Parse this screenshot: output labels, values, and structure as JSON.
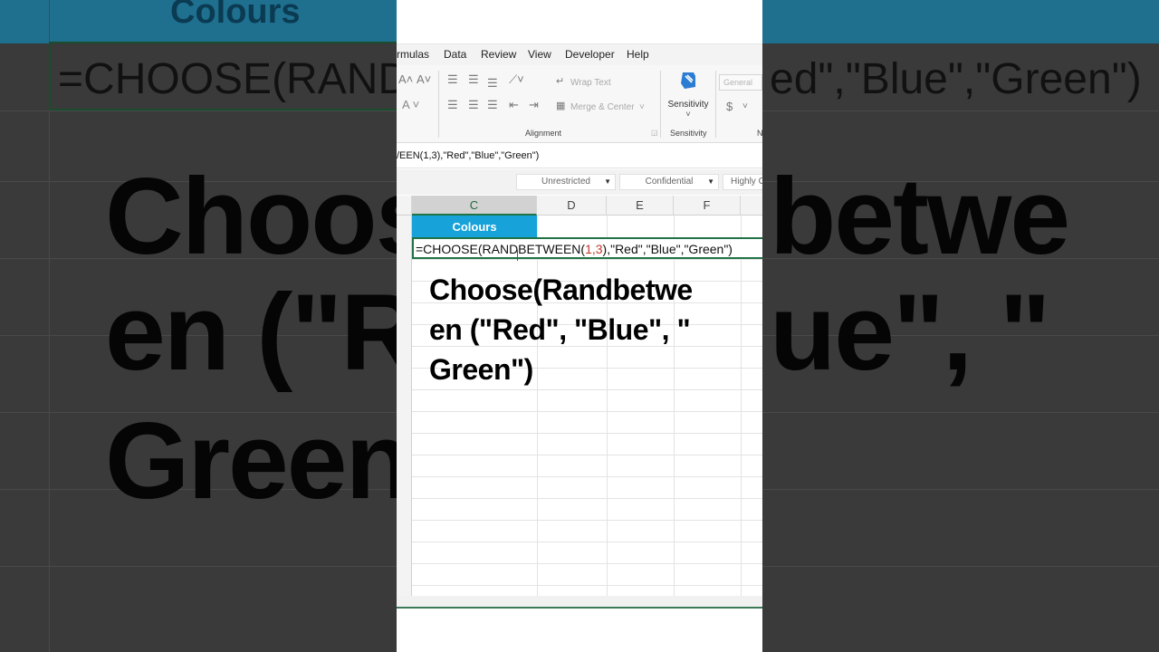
{
  "background": {
    "header_text": "Colours",
    "formula_left": "=CHOOSE(RAND",
    "formula_right": "ed\",\"Blue\",\"Green\")",
    "big_line1_left": "Choos",
    "big_line1_right": "betwe",
    "big_line2_left": "en (\"R",
    "big_line2_right": "ue\", \"",
    "big_line3_left": "Green\""
  },
  "menu": {
    "items": [
      "rmulas",
      "Data",
      "Review",
      "View",
      "Developer",
      "Help"
    ]
  },
  "ribbon": {
    "wrap_text": "Wrap Text",
    "merge_center": "Merge & Center",
    "alignment_label": "Alignment",
    "sensitivity_button": "Sensitivity",
    "sensitivity_label": "Sensitivity",
    "number_format": "General",
    "currency_symbol": "$",
    "number_group_label": "N"
  },
  "formula_bar": {
    "text": "/EEN(1,3),\"Red\",\"Blue\",\"Green\")"
  },
  "sensitivity_labels": [
    "Unrestricted",
    "Confidential",
    "Highly C"
  ],
  "columns": [
    "C",
    "D",
    "E",
    "F"
  ],
  "selected_column": "C",
  "cells": {
    "header": "Colours",
    "formula_prefix": "=CHOOSE(RANDBETWEEN(",
    "formula_args": "1,3",
    "formula_suffix": "),\"Red\",\"Blue\",\"Green\")"
  },
  "overlay": {
    "line1": "Choose(Randbetwe",
    "line2": "en (\"Red\", \"Blue\", \"",
    "line3": "Green\")"
  },
  "colors": {
    "header_fill": "#17a2d9",
    "excel_green": "#217346"
  }
}
